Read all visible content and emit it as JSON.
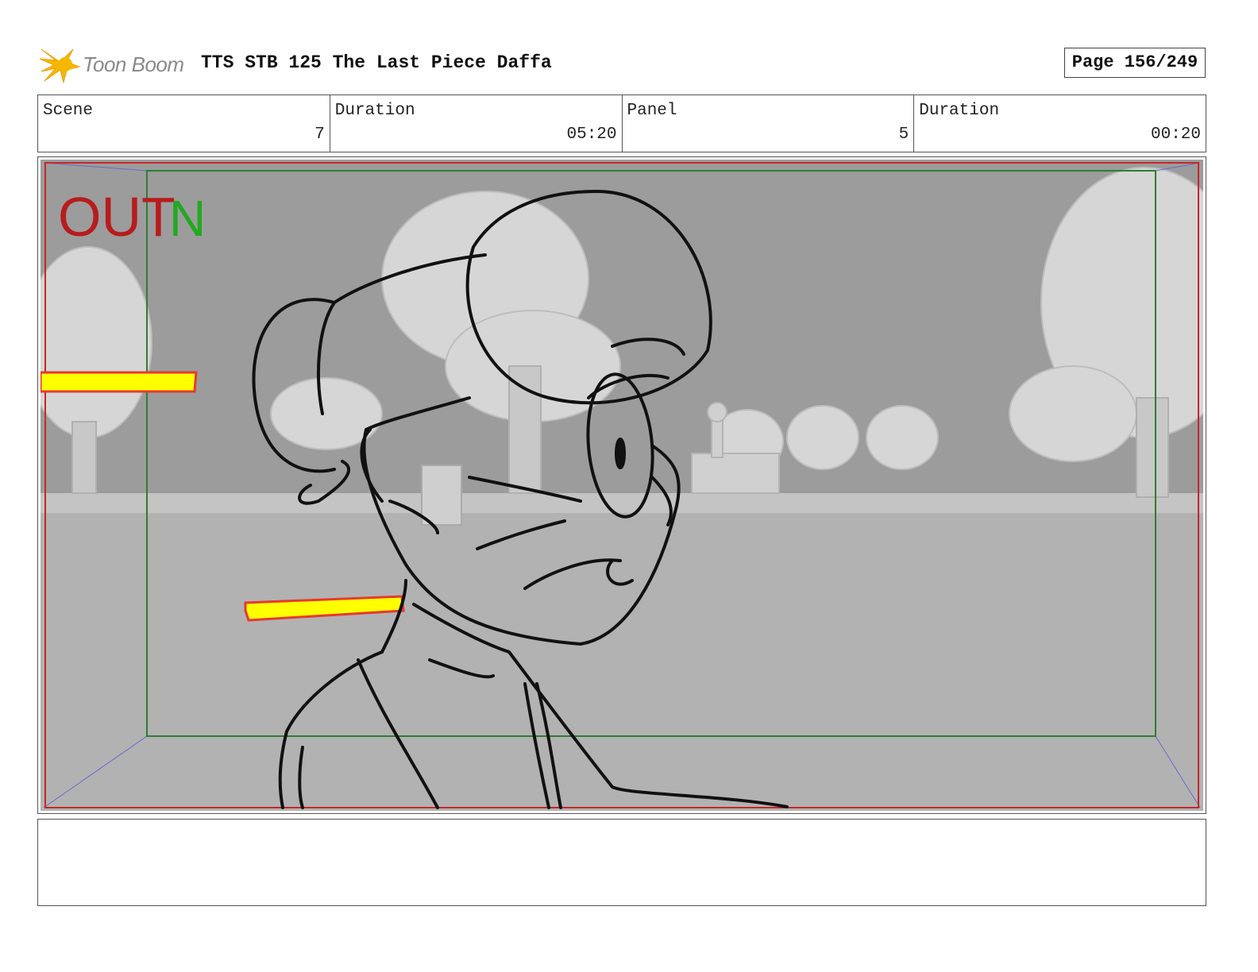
{
  "header": {
    "logo_text": "Toon Boom",
    "project_title": "TTS STB 125 The Last Piece Daffa",
    "page_label": "Page 156/249"
  },
  "info": {
    "scene_label": "Scene",
    "scene_value": "7",
    "scene_duration_label": "Duration",
    "scene_duration_value": "05:20",
    "panel_label": "Panel",
    "panel_value": "5",
    "panel_duration_label": "Duration",
    "panel_duration_value": "00:20"
  },
  "panel": {
    "out_label": "OUT",
    "in_label": "N",
    "colors": {
      "background": "#a9a9a9",
      "safe_area": "#2e7d32",
      "camera_frame": "#c62828",
      "arrow_fill": "#ffff00",
      "arrow_stroke": "#e53935"
    }
  },
  "notes": {
    "text": ""
  }
}
